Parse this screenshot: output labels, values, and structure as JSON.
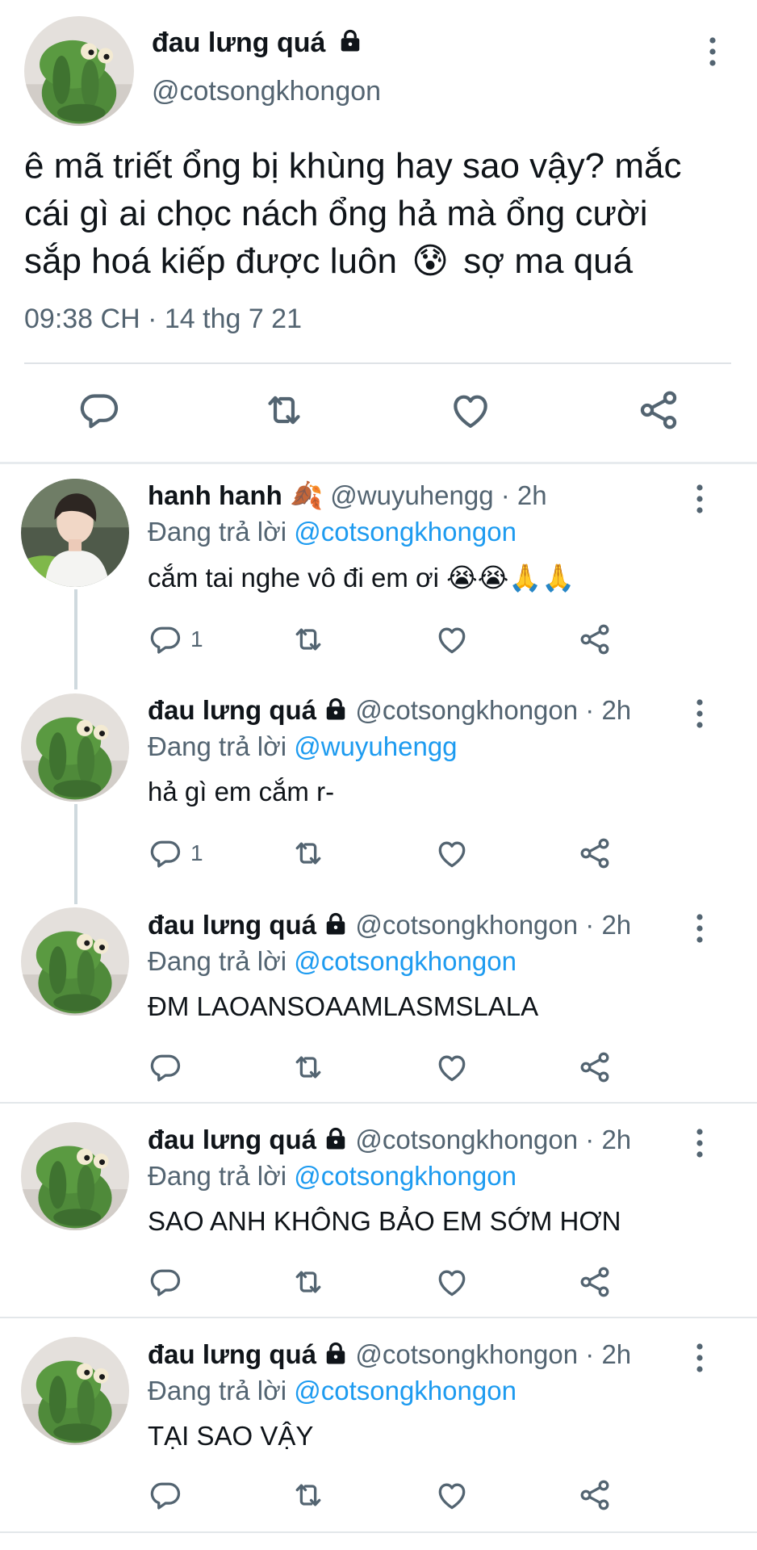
{
  "main_tweet": {
    "name": "đau lưng quá",
    "handle": "@cotsongkhongon",
    "text_lines": [
      "ê mã triết ổng bị khùng hay sao vậy? mắc",
      "cái gì ai chọc nách ổng hả mà ổng cười",
      "sắp hoá kiếp được luôn",
      "sợ ma quá"
    ],
    "emoji": "😰",
    "meta": "09:38 CH · 14 thg 7 21",
    "icons": [
      "reply-icon",
      "retweet-icon",
      "like-icon",
      "share-icon"
    ]
  },
  "replies": [
    {
      "name": "hanh hanh",
      "name_emoji": "🍂",
      "handle": "@wuyuhengg",
      "time": "· 2h",
      "replying_prefix": "Đang trả lời",
      "replying_to": "@cotsongkhongon",
      "text": "cắm tai nghe vô đi em ơi",
      "text_emoji": "😭😭🙏🙏",
      "reply_count": "1"
    },
    {
      "name": "đau lưng quá",
      "handle": "@cotsongkhongon",
      "time": "· 2h",
      "replying_prefix": "Đang trả lời",
      "replying_to": "@wuyuhengg",
      "text": "hả gì em cắm r-",
      "reply_count": "1"
    },
    {
      "name": "đau lưng quá",
      "handle": "@cotsongkhongon",
      "time": "· 2h",
      "replying_prefix": "Đang trả lời",
      "replying_to": "@cotsongkhongon",
      "text": "ĐM LAOANSOAAMLASMSLALA",
      "reply_count": ""
    },
    {
      "name": "đau lưng quá",
      "handle": "@cotsongkhongon",
      "time": "· 2h",
      "replying_prefix": "Đang trả lời",
      "replying_to": "@cotsongkhongon",
      "text": "SAO ANH KHÔNG BẢO EM SỚM HƠN",
      "reply_count": ""
    },
    {
      "name": "đau lưng quá",
      "handle": "@cotsongkhongon",
      "time": "· 2h",
      "replying_prefix": "Đang trả lời",
      "replying_to": "@cotsongkhongon",
      "text": "TẠI SAO VẬY",
      "reply_count": ""
    }
  ],
  "colors": {
    "text": "#0f1419",
    "muted": "#536471",
    "link": "#1d9bf0",
    "divider": "#e3e7ea"
  }
}
